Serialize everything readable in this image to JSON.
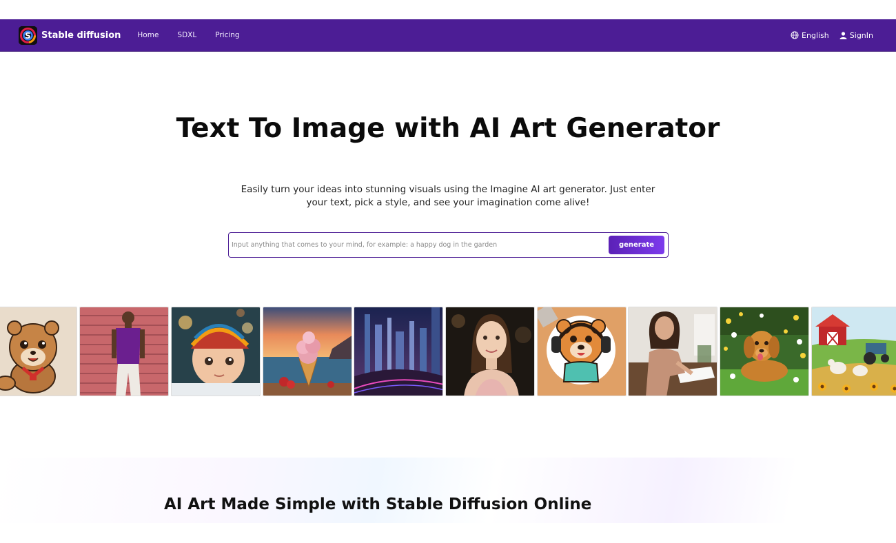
{
  "navbar": {
    "brand": "Stable diffusion",
    "logo_icon": "swirl-logo-icon",
    "links": [
      "Home",
      "SDXL",
      "Pricing"
    ],
    "language": "English",
    "language_icon": "globe-icon",
    "signin": "SignIn",
    "signin_icon": "user-icon",
    "background_color": "#4c1d95"
  },
  "hero": {
    "title": "Text To Image with AI Art Generator",
    "subtitle": "Easily turn your ideas into stunning visuals using the Imagine AI art generator. Just enter your text, pick a style, and see your imagination come alive!",
    "input_placeholder": "Input anything that comes to your mind, for example: a happy dog in the garden",
    "input_value": "",
    "generate_label": "generate"
  },
  "gallery": {
    "images": [
      "cartoon-quokka-image",
      "man-purple-shirt-image",
      "baby-knit-hat-image",
      "ice-cream-sunset-image",
      "futuristic-city-image",
      "woman-portrait-image",
      "bear-headphones-sticker-image",
      "woman-drawing-desk-image",
      "golden-retriever-garden-image",
      "cartoon-farm-image"
    ]
  },
  "section": {
    "title": "AI Art Made Simple with Stable Diffusion Online"
  }
}
